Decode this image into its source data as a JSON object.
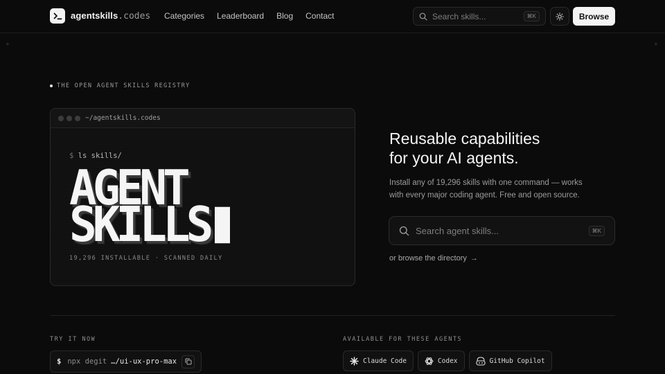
{
  "header": {
    "logo_name": "agentskills",
    "logo_suffix": ".codes",
    "nav": [
      "Categories",
      "Leaderboard",
      "Blog",
      "Contact"
    ],
    "search_placeholder": "Search skills...",
    "search_shortcut": "⌘K",
    "browse_label": "Browse"
  },
  "hero": {
    "eyebrow": "THE OPEN AGENT SKILLS REGISTRY",
    "terminal": {
      "path": "~/agentskills.codes",
      "prompt": "$",
      "command": "ls skills/",
      "big_line1": "AGENT",
      "big_line2": "SKILLS",
      "footer": "19,296 INSTALLABLE · SCANNED DAILY"
    },
    "headline_line1": "Reusable capabilities",
    "headline_line2": "for your AI agents.",
    "subtext": "Install any of 19,296 skills with one command — works with every major coding agent. Free and open source.",
    "search_placeholder": "Search agent skills...",
    "search_shortcut": "⌘K",
    "browse_link": "or browse the directory",
    "browse_arrow": "→"
  },
  "try_it": {
    "label": "TRY IT NOW",
    "dollar": "$",
    "cmd_part1": "npx degit",
    "cmd_part2": "…/ui-ux-pro-max"
  },
  "agents": {
    "label": "AVAILABLE FOR THESE AGENTS",
    "items": [
      {
        "name": "Claude Code",
        "icon": "claude-icon"
      },
      {
        "name": "Codex",
        "icon": "openai-icon"
      },
      {
        "name": "GitHub Copilot",
        "icon": "copilot-icon"
      }
    ]
  }
}
